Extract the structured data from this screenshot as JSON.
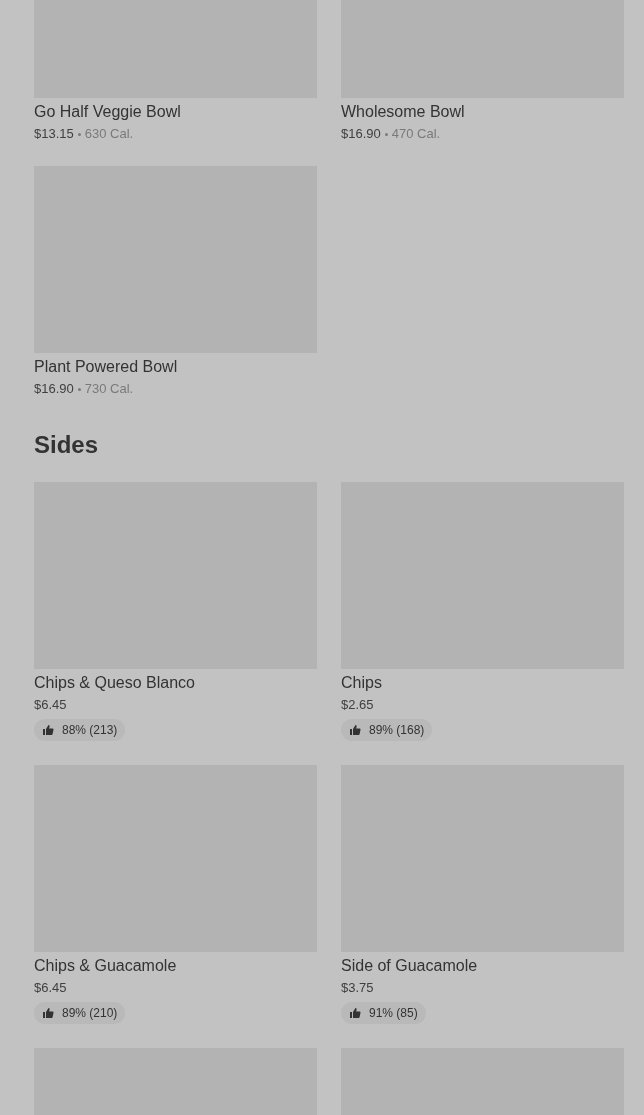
{
  "sections": [
    {
      "items": [
        {
          "kind": "dish",
          "name": "Go Half Veggie Bowl",
          "price": "$13.15",
          "calories": "630 Cal."
        },
        {
          "kind": "dish",
          "name": "Wholesome Bowl",
          "price": "$16.90",
          "calories": "470 Cal."
        },
        {
          "kind": "dish",
          "name": "Plant Powered Bowl",
          "price": "$16.90",
          "calories": "730 Cal."
        }
      ]
    },
    {
      "heading": "Sides",
      "items": [
        {
          "kind": "dish",
          "name": "Chips & Queso Blanco",
          "price": "$6.45",
          "rating": "88% (213)"
        },
        {
          "kind": "dish",
          "name": "Chips",
          "price": "$2.65",
          "rating": "89% (168)"
        },
        {
          "kind": "dish",
          "name": "Chips & Guacamole",
          "price": "$6.45",
          "rating": "89% (210)"
        },
        {
          "kind": "dish",
          "name": "Side of Guacamole",
          "price": "$3.75",
          "rating": "91% (85)"
        },
        {
          "kind": "image_only"
        },
        {
          "kind": "image_only"
        }
      ]
    }
  ]
}
